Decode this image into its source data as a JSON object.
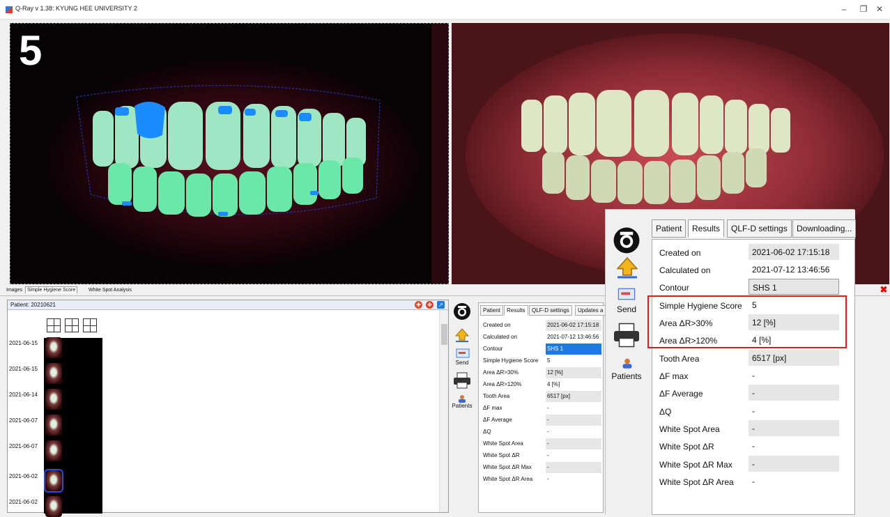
{
  "window": {
    "title": "Q-Ray v 1.38: KYUNG HEE UNIVERSITY 2",
    "minimize": "–",
    "restore": "❐",
    "close": "✕"
  },
  "image": {
    "score_overlay": "5"
  },
  "image_tabs": [
    "Images",
    "Simple Hygiene Score",
    "White Spot Analysis"
  ],
  "patient": {
    "title": "Patient: 20210621",
    "dates": [
      "2021-06-15",
      "2021-06-15",
      "2021-06-14",
      "2021-06-07",
      "2021-06-07",
      "2021-06-02",
      "2021-06-02"
    ],
    "selected_index": 5
  },
  "toolbar": {
    "send_label": "Send",
    "patients_label": "Patients"
  },
  "results": {
    "tabs_small": [
      "Patient",
      "Results",
      "QLF-D settings",
      "Updates a"
    ],
    "tabs_zoom": [
      "Patient",
      "Results",
      "QLF-D settings",
      "Downloading..."
    ],
    "rows": [
      {
        "label": "Created on",
        "value": "2021-06-02 17:15:18"
      },
      {
        "label": "Calculated on",
        "value": "2021-07-12 13:46:56"
      },
      {
        "label": "Contour",
        "value": "SHS 1"
      },
      {
        "label": "Simple Hygiene Score",
        "value": "5"
      },
      {
        "label": "Area ΔR>30%",
        "value": "12 [%]"
      },
      {
        "label": "Area ΔR>120%",
        "value": "4 [%]"
      },
      {
        "label": "Tooth Area",
        "value": "6517 [px]"
      },
      {
        "label": "ΔF max",
        "value": "-"
      },
      {
        "label": "ΔF Average",
        "value": "-"
      },
      {
        "label": "ΔQ",
        "value": "-"
      },
      {
        "label": "White Spot Area",
        "value": "-"
      },
      {
        "label": "White Spot ΔR",
        "value": "-"
      },
      {
        "label": "White Spot ΔR Max",
        "value": "-"
      },
      {
        "label": "White Spot ΔR Area",
        "value": "-"
      }
    ]
  },
  "colors": {
    "highlight": "#e01818",
    "selection": "#1e7ae2"
  }
}
